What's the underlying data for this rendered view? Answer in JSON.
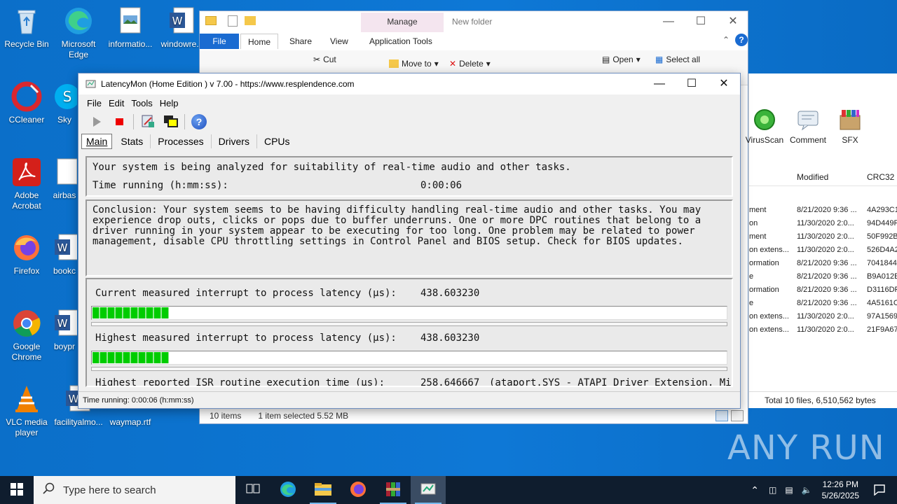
{
  "desktop": {
    "icons": [
      {
        "label": "Recycle Bin"
      },
      {
        "label": "Microsoft Edge"
      },
      {
        "label": "informatio..."
      },
      {
        "label": "windowre..."
      },
      {
        "label": "CCleaner"
      },
      {
        "label": "Sky"
      },
      {
        "label": "Adobe Acrobat"
      },
      {
        "label": "airbas"
      },
      {
        "label": "Firefox"
      },
      {
        "label": "bookc"
      },
      {
        "label": "Google Chrome"
      },
      {
        "label": "boypr"
      },
      {
        "label": "VLC media player"
      },
      {
        "label": "facilityalmo..."
      },
      {
        "label": "waymap.rtf"
      }
    ]
  },
  "explorer": {
    "manage_tab": "Manage",
    "folder_title": "New folder",
    "tabs": [
      "File",
      "Home",
      "Share",
      "View",
      "Application Tools"
    ],
    "ribbon": {
      "cut": "Cut",
      "move_to": "Move to",
      "delete": "Delete",
      "open": "Open",
      "select_all": "Select all"
    },
    "status": {
      "items": "10 items",
      "selected": "1 item selected  5.52 MB"
    }
  },
  "archive_pane": {
    "tools": [
      "VirusScan",
      "Comment",
      "SFX"
    ],
    "columns": {
      "modified": "Modified",
      "crc": "CRC32"
    },
    "rows": [
      {
        "name": "ment",
        "modified": "8/21/2020 9:36 ...",
        "crc": "4A293C1"
      },
      {
        "name": "on",
        "modified": "11/30/2020 2:0...",
        "crc": "94D449F"
      },
      {
        "name": "ment",
        "modified": "11/30/2020 2:0...",
        "crc": "50F992B"
      },
      {
        "name": "on extens...",
        "modified": "11/30/2020 2:0...",
        "crc": "526D4A2"
      },
      {
        "name": "ormation",
        "modified": "8/21/2020 9:36 ...",
        "crc": "7041844"
      },
      {
        "name": "e",
        "modified": "8/21/2020 9:36 ...",
        "crc": "B9A012E"
      },
      {
        "name": "ormation",
        "modified": "8/21/2020 9:36 ...",
        "crc": "D3116DF"
      },
      {
        "name": "e",
        "modified": "8/21/2020 9:36 ...",
        "crc": "4A5161C"
      },
      {
        "name": "on extens...",
        "modified": "11/30/2020 2:0...",
        "crc": "97A1569"
      },
      {
        "name": "on extens...",
        "modified": "11/30/2020 2:0...",
        "crc": "21F9A67"
      }
    ],
    "status": "Total 10 files, 6,510,562 bytes"
  },
  "latencymon": {
    "title": "LatencyMon  (Home Edition ) v 7.00 - https://www.resplendence.com",
    "menu": [
      "File",
      "Edit",
      "Tools",
      "Help"
    ],
    "tabs": [
      "Main",
      "Stats",
      "Processes",
      "Drivers",
      "CPUs"
    ],
    "analyzing_text": "Your system is being analyzed for suitability of real-time audio and other tasks.",
    "time_running_label": "Time running (h:mm:ss):",
    "time_running_value": "0:00:06",
    "conclusion": "Conclusion: Your system seems to be having difficulty handling real-time audio and other tasks. You may experience drop outs, clicks or pops due to buffer underruns. One or more DPC routines that belong to a driver running in your system appear to be executing for too long. One problem may be related to power management, disable CPU throttling settings in Control Panel and BIOS setup. Check for BIOS updates.",
    "current_latency_label": "Current measured interrupt to process latency (µs):",
    "current_latency_value": "438.603230",
    "current_latency_level": 0.12,
    "highest_latency_label": "Highest measured interrupt to process latency (µs):",
    "highest_latency_value": "438.603230",
    "highest_latency_level": 0.12,
    "isr_label": "Highest reported ISR routine execution time (µs):",
    "isr_value": "258.646667",
    "isr_driver": "(ataport.SYS - ATAPI Driver Extension, Micr",
    "status_bar": "Time running: 0:00:06  (h:mm:ss)"
  },
  "watermark": "ANY RUN",
  "taskbar": {
    "search_placeholder": "Type here to search",
    "time": "12:26 PM",
    "date": "5/26/2025"
  }
}
